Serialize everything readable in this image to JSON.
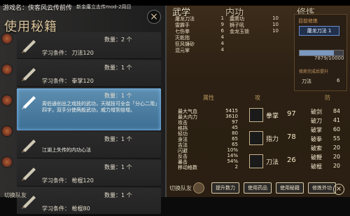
{
  "window": {
    "game_name": "游戏名：侠客风云传前传",
    "subtitle": "新金庸立志传mod-2周目"
  },
  "left_panel": {
    "title": "使用秘籍",
    "close_symbol": "×",
    "items": [
      {
        "name": "",
        "qty": "数量：2 个",
        "req": "学习条件： 刀法120",
        "desc": ""
      },
      {
        "name": "",
        "qty": "数量：1 个",
        "req": "学习条件： 拳掌120",
        "desc": ""
      },
      {
        "name": "",
        "qty": "数量：1 个",
        "req": "",
        "desc": "周伯通创出之戏技的武功，天赋技可全会「分心二用」四字，双手分使两般武功，威力增到倍增。"
      },
      {
        "name": "",
        "qty": "数量：1 个",
        "req": "",
        "desc": "江湖上失传的内功心法"
      },
      {
        "name": "",
        "qty": "数量：1 个",
        "req": "学习条件： 枪棍120",
        "desc": ""
      },
      {
        "name": "",
        "qty": "数量：1 个",
        "req": "学习条件： 枪棍80",
        "desc": ""
      }
    ],
    "footer": "切换队友"
  },
  "right_panel": {
    "tabs": [
      "武学",
      "内功",
      "修炼"
    ],
    "top_table": [
      [
        "屠龙刀法",
        "1",
        "露雳功",
        "10"
      ],
      [
        "雷霹手",
        "9",
        "狮子吼",
        "10"
      ],
      [
        "七伤拳",
        "6",
        "金龙玉锁",
        "10"
      ],
      [
        "灭乾指",
        "4",
        "",
        ""
      ],
      [
        "狂风镰砂",
        "4",
        "",
        ""
      ],
      [
        "混元掌",
        "4",
        "",
        ""
      ]
    ],
    "card": {
      "title": "目前修炼",
      "name": "屠龙刀法  1",
      "progress_text": "7879/10000",
      "progress_value": 0.7879,
      "subtitle": "修炼完成后提升",
      "row_label": "刀法",
      "row_value": "6"
    },
    "headers": {
      "attr": "属性",
      "skill": "攻",
      "resist": "防"
    },
    "stats": [
      [
        "最大气血",
        "5415"
      ],
      [
        "最大内力",
        "3610"
      ],
      [
        "攻击",
        "97"
      ],
      [
        "格挡",
        "45"
      ],
      [
        "轻功",
        "80"
      ],
      [
        "身法",
        "65"
      ],
      [
        "吉法",
        "65"
      ],
      [
        "闪避",
        "10%"
      ],
      [
        "反击",
        "14%"
      ],
      [
        "暴击",
        "54%"
      ],
      [
        "移动格数",
        "2"
      ]
    ],
    "skills": [
      {
        "label": "拳掌",
        "value": "97"
      },
      {
        "label": "指力",
        "value": "78"
      },
      {
        "label": "刀法",
        "value": "26"
      }
    ],
    "resists": [
      [
        "破剑",
        "84"
      ],
      [
        "破刀",
        "41"
      ],
      [
        "破掌",
        "60"
      ],
      [
        "破拳",
        "55"
      ],
      [
        "破索",
        "20"
      ],
      [
        "破鞭",
        "20"
      ],
      [
        "破棍",
        "20"
      ]
    ],
    "buttons": [
      "提升数力",
      "使用药品",
      "使用秘籍",
      "修炼外功"
    ],
    "bottom_left": "切换队友",
    "close_symbol": "×"
  }
}
